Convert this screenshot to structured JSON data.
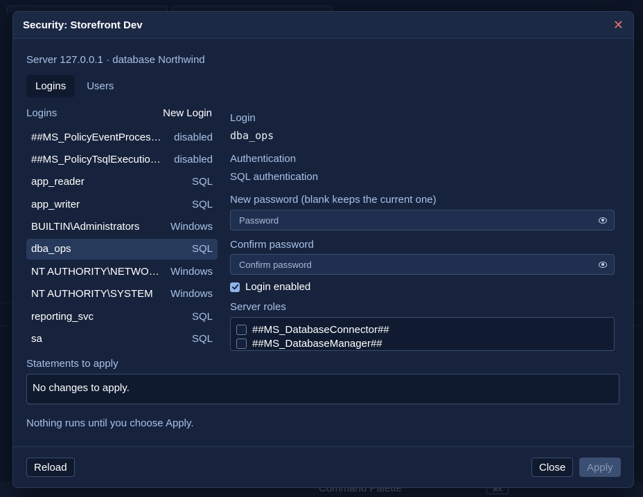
{
  "background": {
    "command_palette_label": "Command Palette",
    "kbd_hint": "⌘K"
  },
  "dialog": {
    "title": "Security: Storefront Dev",
    "server_line": "Server 127.0.0.1 · database Northwind",
    "tabs": [
      {
        "label": "Logins",
        "active": true
      },
      {
        "label": "Users",
        "active": false
      }
    ]
  },
  "logins": {
    "header_label": "Logins",
    "new_login_label": "New Login",
    "items": [
      {
        "name": "##MS_PolicyEventProcessingLogin##",
        "type": "disabled"
      },
      {
        "name": "##MS_PolicyTsqlExecutionLogin##",
        "type": "disabled"
      },
      {
        "name": "app_reader",
        "type": "SQL"
      },
      {
        "name": "app_writer",
        "type": "SQL"
      },
      {
        "name": "BUILTIN\\Administrators",
        "type": "Windows"
      },
      {
        "name": "dba_ops",
        "type": "SQL",
        "selected": true
      },
      {
        "name": "NT AUTHORITY\\NETWORK SERVICE",
        "type": "Windows"
      },
      {
        "name": "NT AUTHORITY\\SYSTEM",
        "type": "Windows"
      },
      {
        "name": "reporting_svc",
        "type": "SQL"
      },
      {
        "name": "sa",
        "type": "SQL"
      }
    ]
  },
  "detail": {
    "login_label": "Login",
    "login_value": "dba_ops",
    "auth_label": "Authentication",
    "auth_value": "SQL authentication",
    "new_password_label": "New password (blank keeps the current one)",
    "password_placeholder": "Password",
    "confirm_label": "Confirm password",
    "confirm_placeholder": "Confirm password",
    "login_enabled_label": "Login enabled",
    "login_enabled": true,
    "server_roles_label": "Server roles",
    "server_roles": [
      {
        "name": "##MS_DatabaseConnector##",
        "checked": false
      },
      {
        "name": "##MS_DatabaseManager##",
        "checked": false
      }
    ]
  },
  "statements": {
    "label": "Statements to apply",
    "content": "No changes to apply.",
    "note": "Nothing runs until you choose Apply."
  },
  "footer": {
    "reload_label": "Reload",
    "close_label": "Close",
    "apply_label": "Apply"
  },
  "colors": {
    "accent": "#8fb4ea",
    "close_icon": "#e8736b",
    "background": "#0d1628",
    "dialog": "#17233d"
  }
}
